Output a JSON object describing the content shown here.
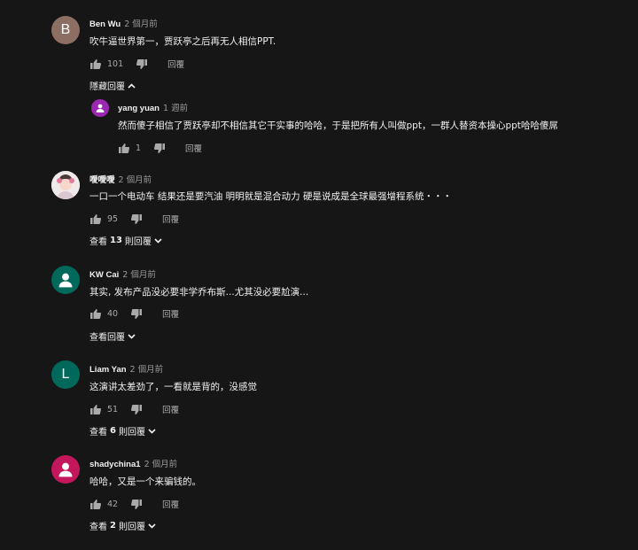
{
  "comments": [
    {
      "author": "Ben Wu",
      "time": "2 個月前",
      "avatar_letter": "B",
      "avatar_color": "#8d6e63",
      "text": "吹牛逼世界第一，贾跃亭之后再无人相信PPT.",
      "likes": "101",
      "reply_label": "回覆",
      "toggle_label": "隱藏回覆",
      "reply": {
        "author": "yang yuan",
        "time": "1 週前",
        "avatar_color": "#9c27b0",
        "text": "然而傻子相信了贾跃亭却不相信其它干实事的哈哈，于是把所有人叫做ppt，一群人替资本操心ppt哈哈傻屌",
        "likes": "1",
        "reply_label": "回覆"
      }
    },
    {
      "author": "噯噯噯",
      "time": "2 個月前",
      "text": "一口一个电动车 结果还是要汽油 明明就是混合动力 硬是说成是全球最强增程系统・・・",
      "likes": "95",
      "reply_label": "回覆",
      "toggle_prefix": "查看",
      "toggle_count": "13",
      "toggle_suffix": "則回覆"
    },
    {
      "author": "KW Cai",
      "time": "2 個月前",
      "avatar_color": "#00695c",
      "text": "其实, 发布产品没必要非学乔布斯...尤其没必要尬演...",
      "likes": "40",
      "reply_label": "回覆",
      "toggle_label": "查看回覆"
    },
    {
      "author": "Liam Yan",
      "time": "2 個月前",
      "avatar_letter": "L",
      "avatar_color": "#00695c",
      "text": "这演讲太差劲了，一看就是背的，没感觉",
      "likes": "51",
      "reply_label": "回覆",
      "toggle_prefix": "查看",
      "toggle_count": "6",
      "toggle_suffix": "則回覆"
    },
    {
      "author": "shadychina1",
      "time": "2 個月前",
      "avatar_color": "#c2185b",
      "text": "哈哈，又是一个来骗钱的。",
      "likes": "42",
      "reply_label": "回覆",
      "toggle_prefix": "查看",
      "toggle_count": "2",
      "toggle_suffix": "則回覆"
    }
  ],
  "icons": {
    "like": "thumb-up-icon",
    "dislike": "thumb-down-icon",
    "chevron_up": "chevron-up-icon",
    "chevron_down": "chevron-down-icon"
  }
}
